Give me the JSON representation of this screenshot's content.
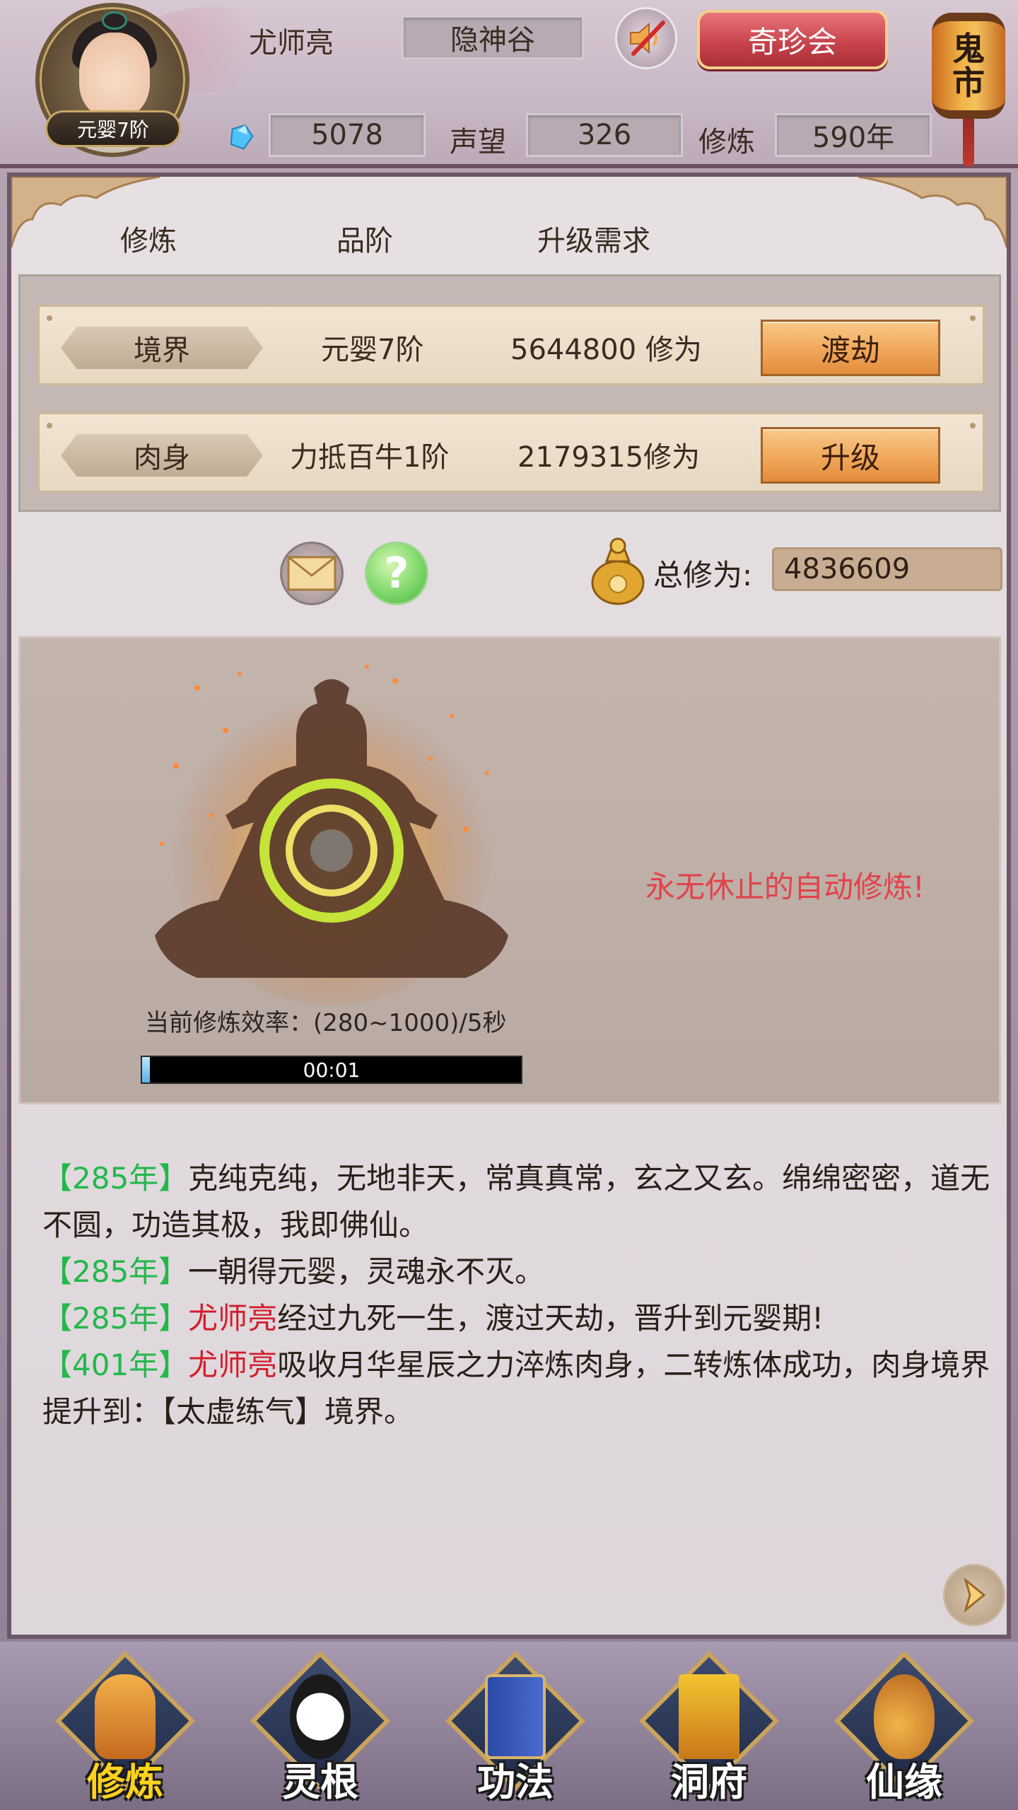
{
  "header": {
    "player_name": "尤师亮",
    "realm_badge": "元婴7阶",
    "location": "隐神谷",
    "treasure_button": "奇珍会",
    "ghost_market": [
      "鬼",
      "市"
    ],
    "spirit_stones": "5078",
    "prestige_label": "声望",
    "prestige": "326",
    "cultivation_label": "修炼",
    "cultivation_years": "590年"
  },
  "columns": [
    "修炼",
    "品阶",
    "升级需求"
  ],
  "requirements": [
    {
      "tag": "境界",
      "level": "元婴7阶",
      "cost": "5644800 修为",
      "button": "渡劫"
    },
    {
      "tag": "肉身",
      "level": "力抵百牛1阶",
      "cost": "2179315修为",
      "button": "升级"
    }
  ],
  "total": {
    "label": "总修为:",
    "value": "4836609"
  },
  "cultivation": {
    "rate_text": "当前修炼效率：(280~1000)/5秒",
    "progress_time": "00:01",
    "progress": 0.02,
    "auto_text": "永无休止的自动修炼!"
  },
  "log": [
    {
      "year": "【285年】",
      "name": "",
      "text": "克纯克纯，无地非天，常真真常，玄之又玄。绵绵密密，道无不圆，功造其极，我即佛仙。"
    },
    {
      "year": "【285年】",
      "name": "",
      "text": "一朝得元婴，灵魂永不灭。"
    },
    {
      "year": "【285年】",
      "name": "尤师亮",
      "text": "经过九死一生，渡过天劫，晋升到元婴期!"
    },
    {
      "year": "【401年】",
      "name": "尤师亮",
      "text": "吸收月华星辰之力淬炼肉身，二转炼体成功，肉身境界提升到：【太虚练气】境界。"
    }
  ],
  "nav": [
    {
      "label": "修炼",
      "icon": "meditation-icon",
      "active": true
    },
    {
      "label": "灵根",
      "icon": "spirit-root-icon",
      "active": false
    },
    {
      "label": "功法",
      "icon": "technique-book-icon",
      "active": false
    },
    {
      "label": "洞府",
      "icon": "cave-residence-icon",
      "active": false
    },
    {
      "label": "仙缘",
      "icon": "immortal-gourd-icon",
      "active": false
    }
  ],
  "colors": {
    "year_green": "#22b84a",
    "name_red": "#d21e2c",
    "auto_text_red": "#e2424a",
    "active_nav_yellow": "#ffd21e"
  }
}
